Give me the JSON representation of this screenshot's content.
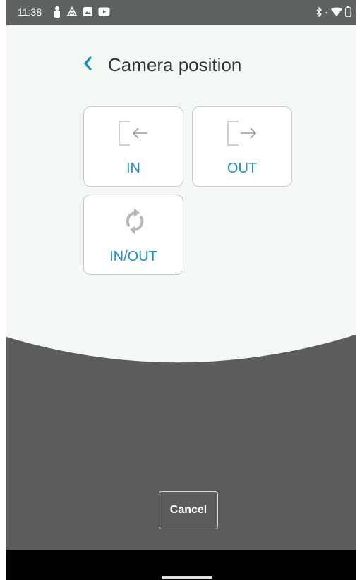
{
  "status_bar": {
    "time": "11:38",
    "left_icons": [
      "person-icon",
      "drive-icon",
      "image-icon",
      "youtube-icon"
    ],
    "right_icons": [
      "bluetooth-icon",
      "wifi-icon",
      "battery-icon"
    ]
  },
  "header": {
    "title": "Camera position",
    "back_icon": "chevron-left-icon"
  },
  "options": [
    {
      "label": "IN",
      "icon": "arrow-left-box-icon"
    },
    {
      "label": "OUT",
      "icon": "arrow-right-box-icon"
    },
    {
      "label": "IN/OUT",
      "icon": "sync-icon"
    }
  ],
  "footer": {
    "cancel_label": "Cancel"
  },
  "colors": {
    "accent": "#1e8dbf",
    "content_bg": "#f4f8f5",
    "overlay_bg": "#5c5c5c",
    "status_bar_bg": "#5f6360"
  }
}
